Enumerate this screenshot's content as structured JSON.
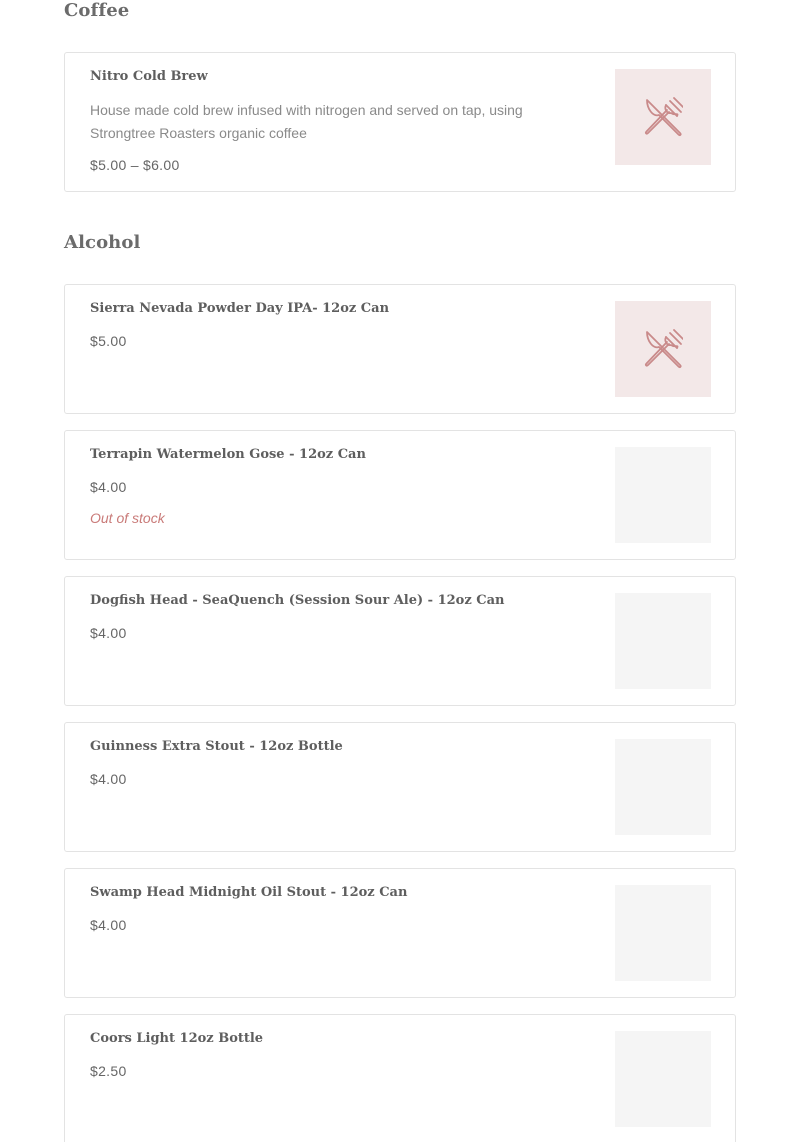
{
  "sections": {
    "coffee": {
      "title": "Coffee"
    },
    "alcohol": {
      "title": "Alcohol"
    }
  },
  "items": [
    {
      "name": "Nitro Cold Brew",
      "description": "House made cold brew infused with nitrogen and served on tap, using Strongtree Roasters organic coffee",
      "price": "$5.00 – $6.00",
      "image": "utensils-placeholder-icon"
    },
    {
      "name": "Sierra Nevada Powder Day IPA- 12oz Can",
      "price": "$5.00",
      "image": "utensils-placeholder-icon"
    },
    {
      "name": "Terrapin Watermelon Gose - 12oz Can",
      "price": "$4.00",
      "stock": "Out of stock",
      "image": "blank"
    },
    {
      "name": "Dogfish Head - SeaQuench (Session Sour Ale) - 12oz Can",
      "price": "$4.00",
      "image": "blank"
    },
    {
      "name": "Guinness Extra Stout - 12oz Bottle",
      "price": "$4.00",
      "image": "blank"
    },
    {
      "name": "Swamp Head Midnight Oil Stout - 12oz Can",
      "price": "$4.00",
      "image": "blank"
    },
    {
      "name": "Coors Light 12oz Bottle",
      "price": "$2.50",
      "image": "blank"
    }
  ],
  "colors": {
    "placeholder_bg": "#f3e8e8",
    "placeholder_icon": "#c98a8a",
    "blank_image_bg": "#f5f5f5",
    "out_of_stock": "#c97a78",
    "card_border": "#e3e3e3"
  }
}
